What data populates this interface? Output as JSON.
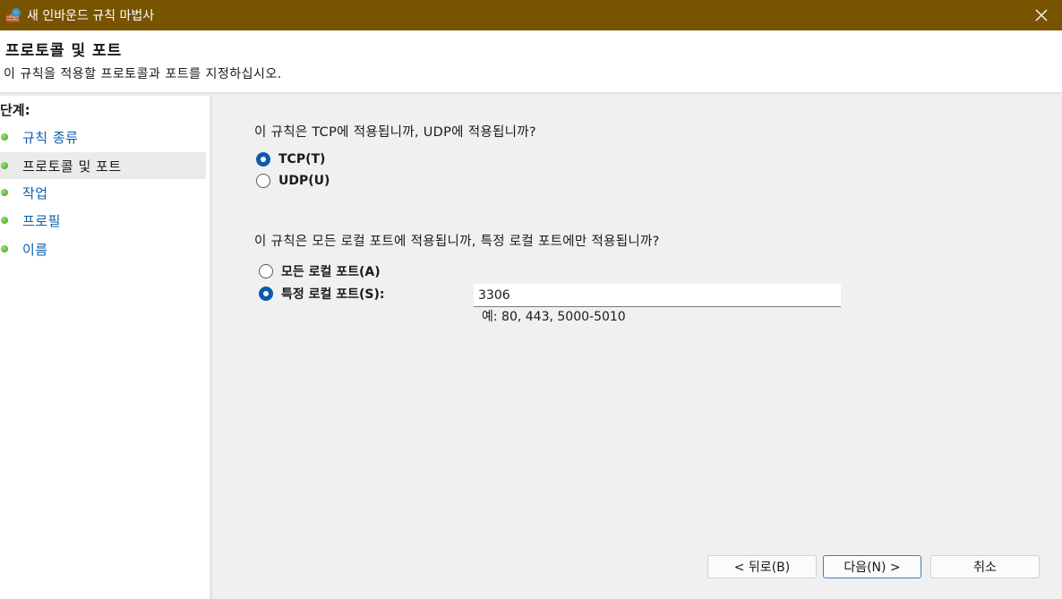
{
  "window": {
    "title": "새 인바운드 규칙 마법사",
    "titlebar_color": "#785400",
    "close_icon": "close-icon"
  },
  "header": {
    "title": "프로토콜 및 포트",
    "subtitle": "이 규칙을 적용할 프로토콜과 포트를 지정하십시오."
  },
  "sidebar": {
    "heading": "단계:",
    "steps": [
      {
        "label": "규칙 종류",
        "active": false
      },
      {
        "label": "프로토콜 및 포트",
        "active": true
      },
      {
        "label": "작업",
        "active": false
      },
      {
        "label": "프로필",
        "active": false
      },
      {
        "label": "이름",
        "active": false
      }
    ]
  },
  "main": {
    "protocol_question": "이 규칙은 TCP에 적용됩니까, UDP에 적용됩니까?",
    "protocol_options": [
      {
        "label": "TCP(T)",
        "checked": true
      },
      {
        "label": "UDP(U)",
        "checked": false
      }
    ],
    "port_question": "이 규칙은 모든 로컬 포트에 적용됩니까, 특정 로컬 포트에만 적용됩니까?",
    "port_options": [
      {
        "label": "모든 로컬 포트(A)",
        "checked": false
      },
      {
        "label": "특정 로컬 포트(S):",
        "checked": true
      }
    ],
    "port_value": "3306",
    "port_example": "예: 80, 443, 5000-5010"
  },
  "buttons": {
    "back": "< 뒤로(B)",
    "next": "다음(N) >",
    "cancel": "취소"
  }
}
